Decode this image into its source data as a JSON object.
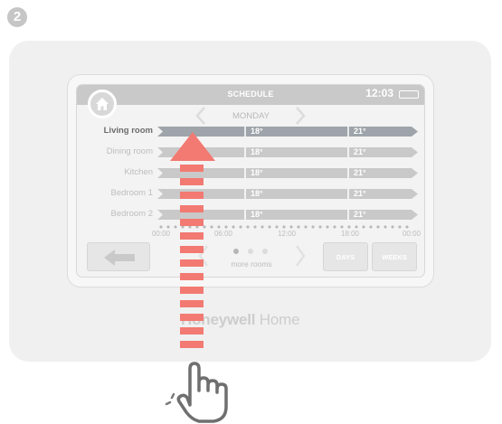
{
  "step_number": "2",
  "screen": {
    "title": "SCHEDULE",
    "clock": "12:03",
    "day": "MONDAY"
  },
  "schedule": {
    "rooms": [
      {
        "name": "Living room",
        "temps": [
          "18°",
          "21°"
        ],
        "active": true
      },
      {
        "name": "Dining room",
        "temps": [
          "18°",
          "21°"
        ],
        "active": false
      },
      {
        "name": "Kitchen",
        "temps": [
          "18°",
          "21°"
        ],
        "active": false
      },
      {
        "name": "Bedroom 1",
        "temps": [
          "18°",
          "21°"
        ],
        "active": false
      },
      {
        "name": "Bedroom 2",
        "temps": [
          "18°",
          "21°"
        ],
        "active": false
      }
    ],
    "time_labels": [
      "00:00",
      "06:00",
      "12:00",
      "18:00",
      "00:00"
    ]
  },
  "footer": {
    "more_rooms": "more rooms",
    "days_label": "DAYS",
    "weeks_label": "WEEKS",
    "page_indicator": {
      "pages": 3,
      "current": 1
    }
  },
  "brand": {
    "bold": "Honeywell",
    "light": " Home"
  },
  "colors": {
    "active_bar": "#9ea4aa",
    "inactive_bar": "#c9c9c9",
    "gesture_arrow": "#f27a72",
    "device_body": "#f0f0f0",
    "hand_outline": "#6f6f6f"
  },
  "icons": {
    "home": "home-icon",
    "back": "back-arrow-icon",
    "swipe": "swipe-up-arrow-icon",
    "hand": "pointing-hand-icon"
  }
}
